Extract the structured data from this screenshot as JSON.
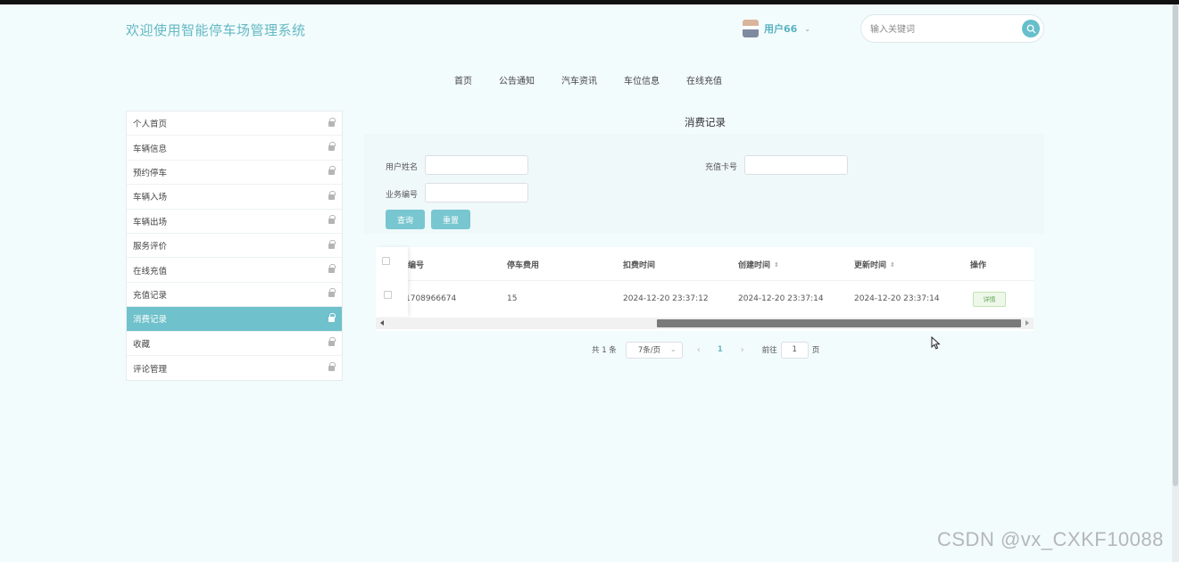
{
  "header": {
    "site_title": "欢迎使用智能停车场管理系统",
    "user_name": "用户66",
    "user_caret": "⌄",
    "search_placeholder": "输入关键词"
  },
  "nav": {
    "items": [
      {
        "label": "首页"
      },
      {
        "label": "公告通知"
      },
      {
        "label": "汽车资讯"
      },
      {
        "label": "车位信息"
      },
      {
        "label": "在线充值"
      }
    ]
  },
  "sidebar": {
    "items": [
      {
        "label": "个人首页",
        "active": false
      },
      {
        "label": "车辆信息",
        "active": false
      },
      {
        "label": "预约停车",
        "active": false
      },
      {
        "label": "车辆入场",
        "active": false
      },
      {
        "label": "车辆出场",
        "active": false
      },
      {
        "label": "服务评价",
        "active": false
      },
      {
        "label": "在线充值",
        "active": false
      },
      {
        "label": "充值记录",
        "active": false
      },
      {
        "label": "消费记录",
        "active": true
      },
      {
        "label": "收藏",
        "active": false
      },
      {
        "label": "评论管理",
        "active": false
      }
    ]
  },
  "main": {
    "page_title": "消费记录",
    "filters": {
      "user_name_label": "用户姓名",
      "card_no_label": "充值卡号",
      "business_no_label": "业务编号",
      "user_name_value": "",
      "card_no_value": "",
      "business_no_value": ""
    },
    "buttons": {
      "search": "查询",
      "reset": "重置"
    },
    "table": {
      "columns": [
        "编号",
        "停车费用",
        "扣费时间",
        "创建时间",
        "更新时间",
        "操作"
      ],
      "sort_icon": "⇕",
      "rows": [
        {
          "id": "1708966674",
          "fee": "15",
          "deduct_time": "2024-12-20 23:37:12",
          "create_time": "2024-12-20 23:37:14",
          "update_time": "2024-12-20 23:37:14",
          "action": "详情"
        }
      ]
    },
    "pagination": {
      "total": "共 1 条",
      "page_size": "7条/页",
      "prev": "‹",
      "current": "1",
      "next": "›",
      "goto_label": "前往",
      "goto_value": "1",
      "page_unit": "页"
    }
  },
  "watermark": "CSDN @vx_CXKF10088",
  "colors": {
    "accent": "#6fc1cb",
    "background": "#f3fcfd",
    "title": "#63b9c4"
  }
}
